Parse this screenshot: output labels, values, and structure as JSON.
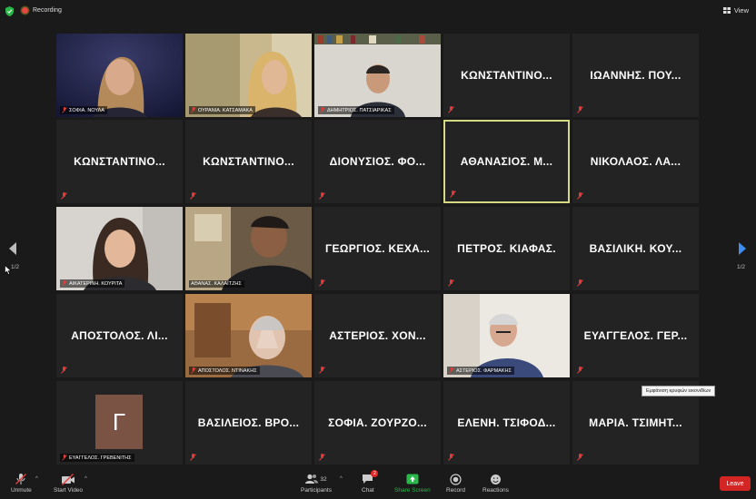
{
  "topbar": {
    "recording_label": "Recording",
    "view_label": "View"
  },
  "tiles": [
    {
      "name": "ΣΟΦΙΑ. ΝΟΥΛΑ",
      "video": true
    },
    {
      "name": "ΟΥΡΑΝΙΑ. ΚΑΤΣΑΜΑΚΑ",
      "video": true
    },
    {
      "name": "ΔΗΜΗΤΡΙΟΣ. ΠΑΤΣΙΑΡΙΚΑΣ",
      "video": true
    },
    {
      "name": "ΚΩΝΣΤΑΝΤΙΝΟ...",
      "video": false
    },
    {
      "name": "ΙΩΑΝΝΗΣ. ΠΟΥ...",
      "video": false
    },
    {
      "name": "ΚΩΝΣΤΑΝΤΙΝΟ...",
      "video": false
    },
    {
      "name": "ΚΩΝΣΤΑΝΤΙΝΟ...",
      "video": false
    },
    {
      "name": "ΔΙΟΝΥΣΙΟΣ. ΦΟ...",
      "video": false
    },
    {
      "name": "ΑΘΑΝΑΣΙΟΣ. Μ...",
      "video": false,
      "active": true
    },
    {
      "name": "ΝΙΚΟΛΑΟΣ. ΛΑ...",
      "video": false
    },
    {
      "name": "ΑΙΚΑΤΕΡΙΝΗ. ΚΟΥΡΙΤΑ",
      "video": true
    },
    {
      "name": "ΑΘΑΝΑΣ. ΚΑΛΑΪΤΖΗΣ",
      "video": true
    },
    {
      "name": "ΓΕΩΡΓΙΟΣ. ΚΕΧΑ...",
      "video": false
    },
    {
      "name": "ΠΕΤΡΟΣ. ΚΙΑΦΑΣ.",
      "video": false
    },
    {
      "name": "ΒΑΣΙΛΙΚΗ. ΚΟΥ...",
      "video": false
    },
    {
      "name": "ΑΠΟΣΤΟΛΟΣ. ΛΙ...",
      "video": false
    },
    {
      "name": "ΑΠΟΣΤΟΛΟΣ. ΝΤΙΝΑΚΗΣ",
      "video": true
    },
    {
      "name": "ΑΣΤΕΡΙΟΣ. ΧΟΝ...",
      "video": false
    },
    {
      "name": "ΑΣΤΕΡΙΟΣ. ΦΑΡΜΑΚΗΣ",
      "video": true
    },
    {
      "name": "ΕΥΑΓΓΕΛΟΣ. ΓΕΡ...",
      "video": false
    },
    {
      "name": "ΕΥΑΓΓΕΛΟΣ. ΓΡΕΒΕΝΙΤΗΣ",
      "video": false,
      "avatar": "Γ"
    },
    {
      "name": "ΒΑΣΙΛΕΙΟΣ. ΒΡΟ...",
      "video": false
    },
    {
      "name": "ΣΟΦΙΑ. ΖΟΥΡΖΟ...",
      "video": false
    },
    {
      "name": "ΕΛΕΝΗ. ΤΣΙΦΟΔ...",
      "video": false
    },
    {
      "name": "ΜΑΡΙΑ. ΤΣΙΜΗΤ...",
      "video": false
    }
  ],
  "avatar_letter": "Γ",
  "pagination": {
    "left": "1/2",
    "right": "1/2"
  },
  "tooltip": "Εμφάνιση κρυφών εικονιδίων",
  "toolbar": {
    "unmute": "Unmute",
    "start_video": "Start Video",
    "participants": "Participants",
    "participants_count": "32",
    "chat": "Chat",
    "chat_badge": "2",
    "share_screen": "Share Screen",
    "record": "Record",
    "reactions": "Reactions",
    "leave": "Leave"
  },
  "colors": {
    "active_border": "#d6d983",
    "share": "#2ab84a",
    "leave": "#d42525",
    "muted": "#e23b3b"
  }
}
